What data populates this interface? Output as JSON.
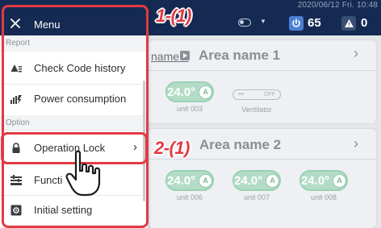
{
  "header": {
    "datetime": "2020/06/12 Fri. 10:48",
    "power_on_count": "65",
    "alarm_count": "0"
  },
  "menu": {
    "title": "Menu",
    "sections": [
      {
        "label": "Report",
        "items": [
          {
            "label": "Check Code history",
            "icon": "alarm-history-icon"
          },
          {
            "label": "Power consumption",
            "icon": "bar-chart-icon"
          }
        ]
      },
      {
        "label": "Option",
        "items": [
          {
            "label": "Operation Lock",
            "icon": "lock-icon",
            "has_submenu": true
          },
          {
            "label": "Functi",
            "icon": "function-icon"
          },
          {
            "label": "Initial setting",
            "icon": "gear-box-icon"
          }
        ]
      }
    ]
  },
  "areas": [
    {
      "link": "name 1",
      "name": "Area name 1",
      "units": [
        {
          "temp": "24.0",
          "mode": "A",
          "label": "unit 003"
        },
        {
          "type": "ventilator",
          "state": "OFF",
          "dots": "•••",
          "label": "Ventilator"
        }
      ]
    },
    {
      "name": "Area name 2",
      "units": [
        {
          "temp": "24.0",
          "mode": "A",
          "label": "unit 006"
        },
        {
          "temp": "24.0",
          "mode": "A",
          "label": "unit 007"
        },
        {
          "temp": "24.0",
          "mode": "A",
          "label": "unit 008"
        }
      ]
    }
  ],
  "annotations": {
    "step1": "1-(1)",
    "step2": "2-(1)",
    "color": "#e23a45"
  },
  "colors": {
    "header_bg": "#152a52",
    "unit_on": "#b3dcc7",
    "accent": "#4b7fd6"
  }
}
